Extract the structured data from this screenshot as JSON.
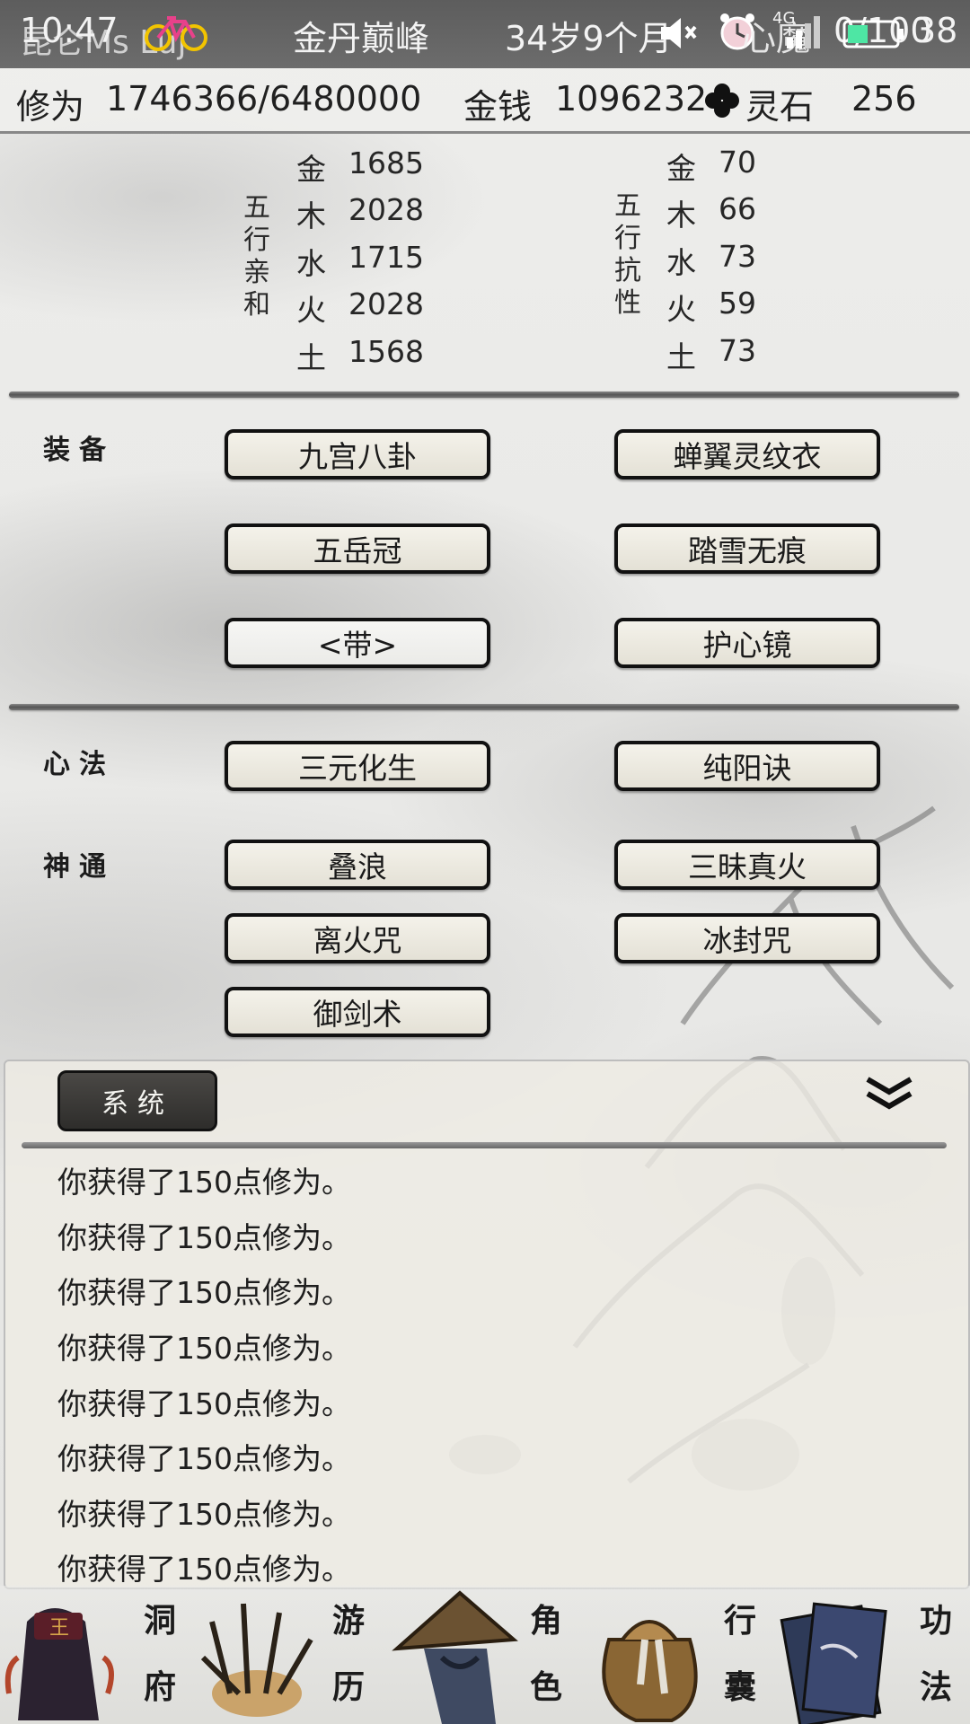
{
  "status_bar": {
    "time": "10:47",
    "left_overlay": "昆仑Ms Luj",
    "realm": "金丹巅峰",
    "age": "34岁9个月",
    "heart_demon_label": "心魔",
    "heart_demon_value": "0/100",
    "battery": "38",
    "network": "4G"
  },
  "resources": {
    "cultivation_label": "修为",
    "cultivation_value": "1746366/6480000",
    "money_label": "金钱",
    "money_value": "1096232",
    "spirit_stone_label": "灵石",
    "spirit_stone_value": "256"
  },
  "affinity": {
    "label_chars": [
      "五",
      "行",
      "亲",
      "和"
    ],
    "rows": [
      {
        "element": "金",
        "value": "1685"
      },
      {
        "element": "木",
        "value": "2028"
      },
      {
        "element": "水",
        "value": "1715"
      },
      {
        "element": "火",
        "value": "2028"
      },
      {
        "element": "土",
        "value": "1568"
      }
    ]
  },
  "resistance": {
    "label_chars": [
      "五",
      "行",
      "抗",
      "性"
    ],
    "rows": [
      {
        "element": "金",
        "value": "70"
      },
      {
        "element": "木",
        "value": "66"
      },
      {
        "element": "水",
        "value": "73"
      },
      {
        "element": "火",
        "value": "59"
      },
      {
        "element": "土",
        "value": "73"
      }
    ]
  },
  "equipment": {
    "label": "装备",
    "slots": [
      "九宫八卦",
      "蝉翼灵纹衣",
      "五岳冠",
      "踏雪无痕",
      "<带>",
      "护心镜"
    ]
  },
  "mind_method": {
    "label": "心法",
    "items": [
      "三元化生",
      "纯阳诀"
    ]
  },
  "divine_powers": {
    "label": "神通",
    "items": [
      "叠浪",
      "三昧真火",
      "离火咒",
      "冰封咒",
      "御剑术"
    ]
  },
  "log_panel": {
    "tab_label": "系统",
    "messages": [
      "你获得了150点修为。",
      "你获得了150点修为。",
      "你获得了150点修为。",
      "你获得了150点修为。",
      "你获得了150点修为。",
      "你获得了150点修为。",
      "你获得了150点修为。",
      "你获得了150点修为。"
    ]
  },
  "nav": [
    {
      "chars": [
        "洞",
        "府"
      ],
      "icon": "cave-dwelling-icon"
    },
    {
      "chars": [
        "游",
        "历"
      ],
      "icon": "travel-grass-icon"
    },
    {
      "chars": [
        "角",
        "色"
      ],
      "icon": "character-hat-icon"
    },
    {
      "chars": [
        "行",
        "囊"
      ],
      "icon": "bag-icon"
    },
    {
      "chars": [
        "功",
        "法"
      ],
      "icon": "scroll-books-icon"
    }
  ],
  "colors": {
    "button_border": "#111111",
    "button_fill": "#efece2",
    "tab_fill": "#3a3936"
  }
}
